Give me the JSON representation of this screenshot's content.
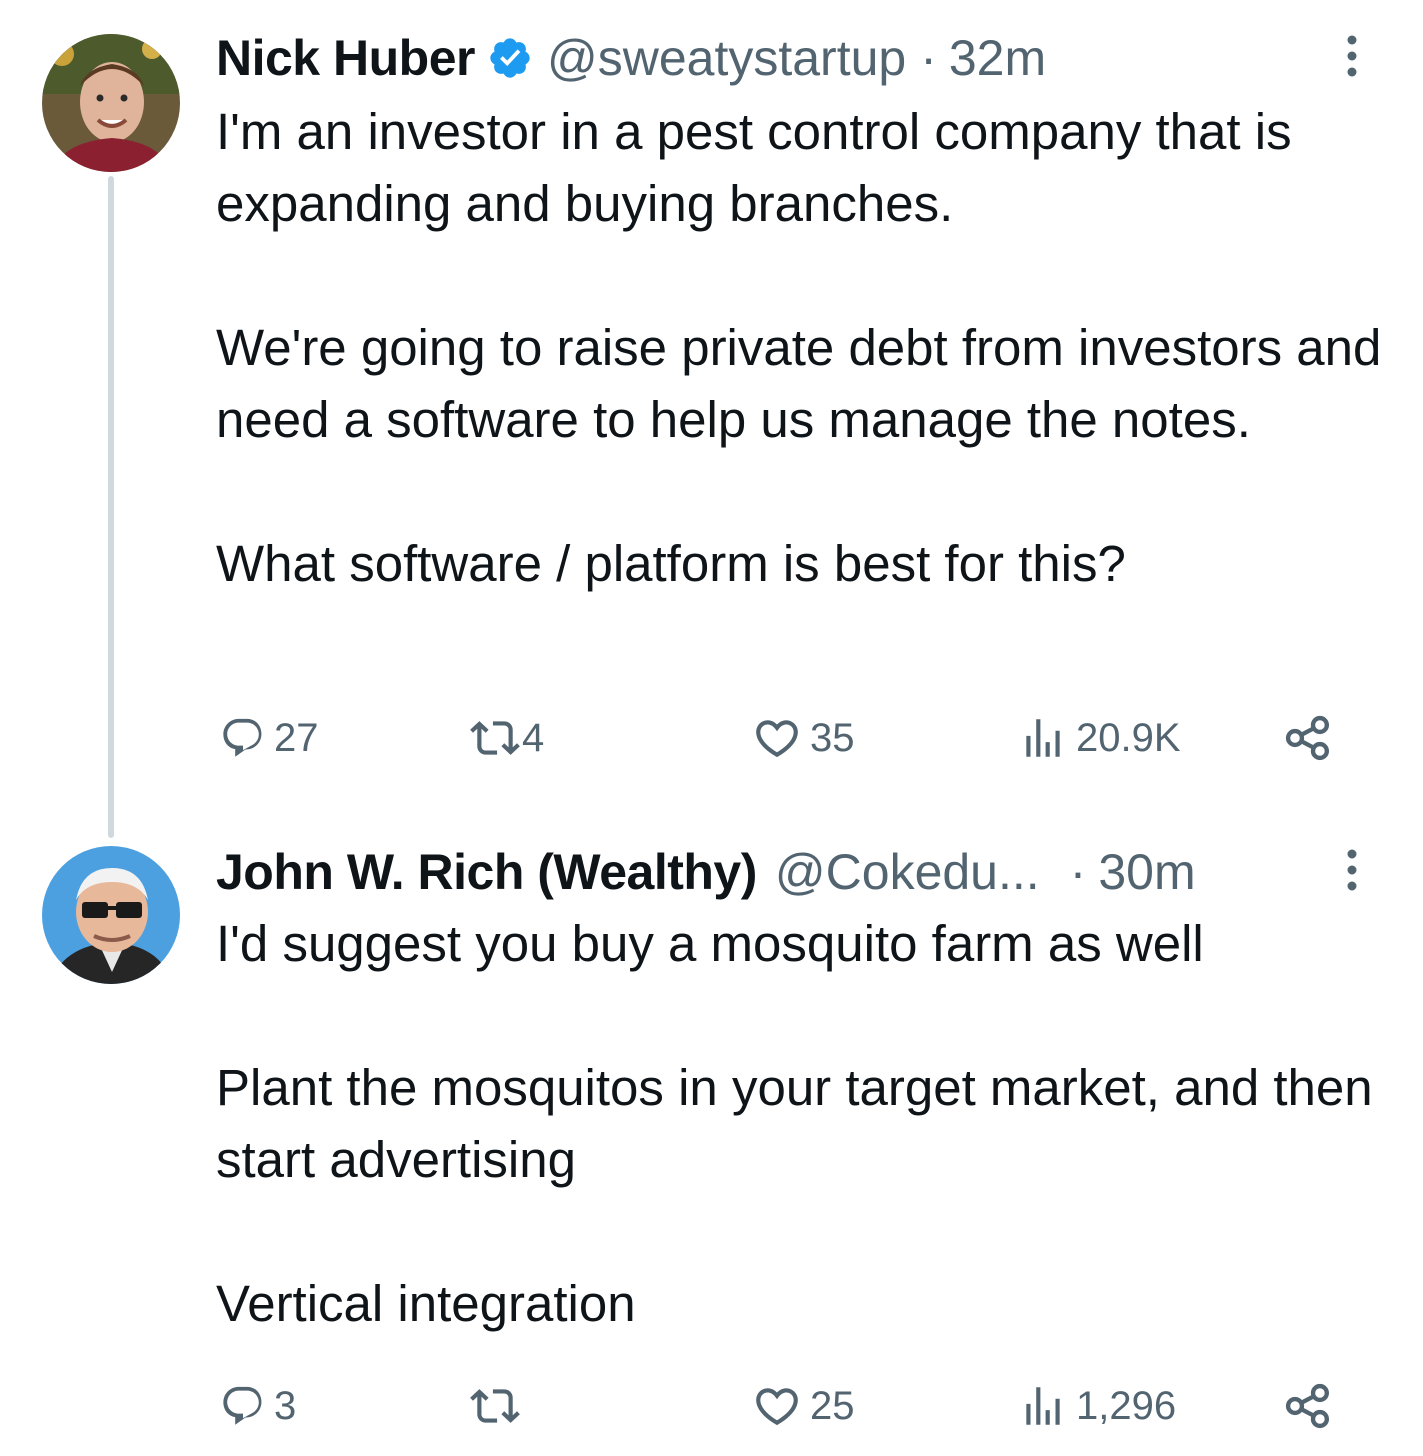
{
  "tweets": [
    {
      "name": "Nick Huber",
      "handle": "@sweatystartup",
      "separator": "·",
      "time": "32m",
      "text": "I'm an investor in a pest control company that is expanding and buying branches.\n\nWe're going to raise private debt from investors and need a software to help us manage the notes.\n\nWhat software / platform is best for this?",
      "stats": {
        "replies": "27",
        "retweets": "4",
        "likes": "35",
        "views": "20.9K"
      }
    },
    {
      "name": "John W. Rich (Wealthy)",
      "handle": "@Cokedu...",
      "separator": "·",
      "time": "30m",
      "text": "I'd suggest you buy a mosquito farm as well\n\nPlant the mosquitos in your target market, and then start advertising\n\nVertical integration",
      "stats": {
        "replies": "3",
        "retweets": "",
        "likes": "25",
        "views": "1,296"
      }
    }
  ],
  "colors": {
    "verified": "#1d9bf0",
    "muted": "#536471",
    "thread_line": "#cfd9de",
    "text": "#0f1419"
  },
  "icons": [
    "reply-icon",
    "retweet-icon",
    "like-icon",
    "views-icon",
    "share-icon",
    "more-icon",
    "verified-badge-icon"
  ]
}
